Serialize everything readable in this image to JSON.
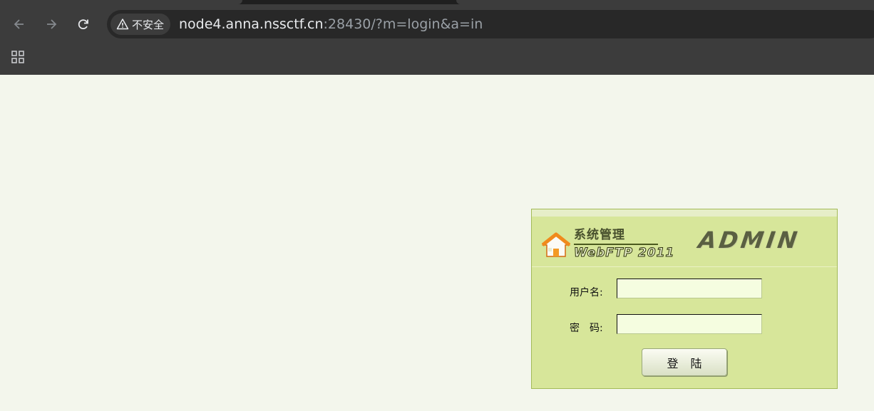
{
  "browser": {
    "security_label": "不安全",
    "url_host": "node4.anna.nssctf.cn",
    "url_rest": ":28430/?m=login&a=in",
    "icons": {
      "back": "arrow-left-icon",
      "forward": "arrow-right-icon",
      "reload": "reload-icon",
      "warning": "warning-triangle-icon",
      "apps": "apps-grid-icon"
    }
  },
  "login": {
    "brand_title": "系统管理",
    "brand_subtitle": "WebFTP 2011",
    "brand_badge": "ADMIN",
    "username_label": "用户名:",
    "username_value": "",
    "password_label": "密　码:",
    "password_value": "",
    "submit_label": "登 陆",
    "logo_icon": "house-icon",
    "colors": {
      "panel_bg": "#d7e69a",
      "panel_border": "#a3bb57",
      "input_bg": "#f5fde0",
      "page_bg": "#f3f6ec"
    }
  }
}
